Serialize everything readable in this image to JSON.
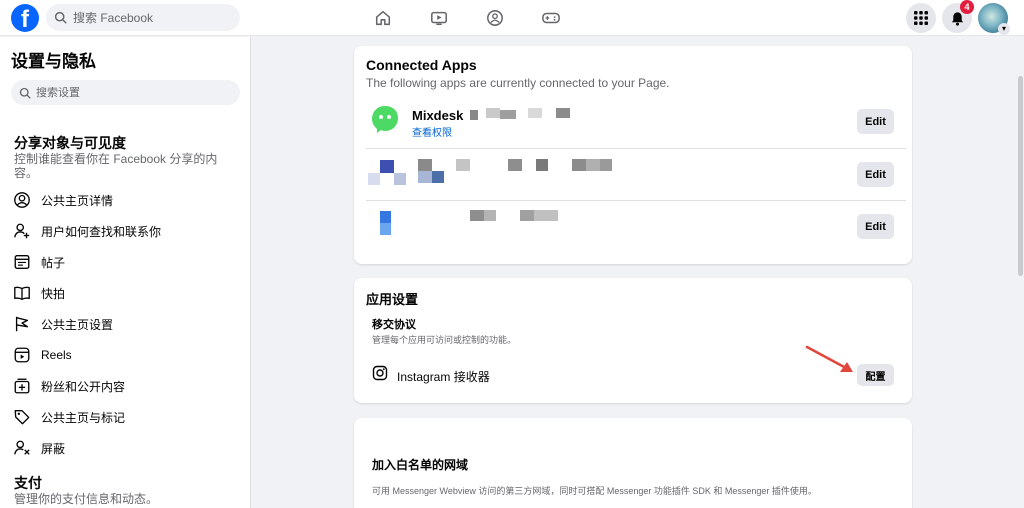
{
  "topbar": {
    "logo_letter": "f",
    "search_placeholder": "搜索 Facebook",
    "notification_count": "4"
  },
  "sidebar": {
    "title": "设置与隐私",
    "search_placeholder": "搜索设置",
    "section1": {
      "title": "分享对象与可见度",
      "desc": "控制谁能查看你在 Facebook 分享的内容。",
      "items": [
        {
          "label": "公共主页详情",
          "icon": "person-circle-icon"
        },
        {
          "label": "用户如何查找和联系你",
          "icon": "person-add-icon"
        },
        {
          "label": "帖子",
          "icon": "post-icon"
        },
        {
          "label": "快拍",
          "icon": "book-icon"
        },
        {
          "label": "公共主页设置",
          "icon": "flag-icon"
        },
        {
          "label": "Reels",
          "icon": "reels-icon"
        },
        {
          "label": "粉丝和公开内容",
          "icon": "plus-box-icon"
        },
        {
          "label": "公共主页与标记",
          "icon": "tag-icon"
        },
        {
          "label": "屏蔽",
          "icon": "block-user-icon"
        }
      ]
    },
    "section2": {
      "title": "支付",
      "desc": "管理你的支付信息和动态。"
    }
  },
  "connected_apps": {
    "title": "Connected Apps",
    "subtitle": "The following apps are currently connected to your Page.",
    "apps": [
      {
        "name": "Mixdesk",
        "link": "查看权限",
        "edit_label": "Edit"
      },
      {
        "edit_label": "Edit"
      },
      {
        "edit_label": "Edit"
      }
    ]
  },
  "app_settings": {
    "title": "应用设置",
    "handover_title": "移交协议",
    "handover_desc": "管理每个应用可访问或控制的功能。",
    "receiver_label": "Instagram 接收器",
    "configure_label": "配置"
  },
  "whitelist": {
    "title": "加入白名单的网域",
    "desc": "可用 Messenger Webview 访问的第三方网域，同时可搭配 Messenger 功能插件 SDK 和 Messenger 插件使用。"
  },
  "colors": {
    "brand": "#0866ff",
    "link": "#0064d1",
    "arrow": "#e0463a",
    "mixdesk_green": "#4cd964"
  }
}
